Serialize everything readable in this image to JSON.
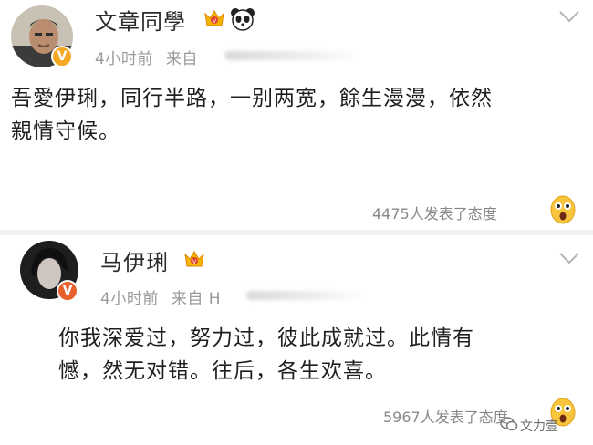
{
  "posts": [
    {
      "author": "文章同學",
      "time": "4小时前",
      "source_prefix": "来自",
      "text_line1": "吾愛伊琍，同行半路，一别两宽，餘生漫漫，依然",
      "text_line2": "親情守候。",
      "reactions": "4475人发表了态度",
      "badges": [
        "crown-icon",
        "panda-icon"
      ]
    },
    {
      "author": "马伊琍",
      "time": "4小时前",
      "source_prefix": "来自 H",
      "text_line1": "你我深爱过，努力过，彼此成就过。此情有",
      "text_line2": "憾，然无对错。往后，各生欢喜。",
      "reactions": "5967人发表了态度",
      "badges": [
        "crown-icon"
      ]
    }
  ],
  "watermark": "文力壹",
  "colors": {
    "verified": "#f5a623",
    "divider": "#f2f2f2",
    "meta": "#9a9a9a"
  }
}
